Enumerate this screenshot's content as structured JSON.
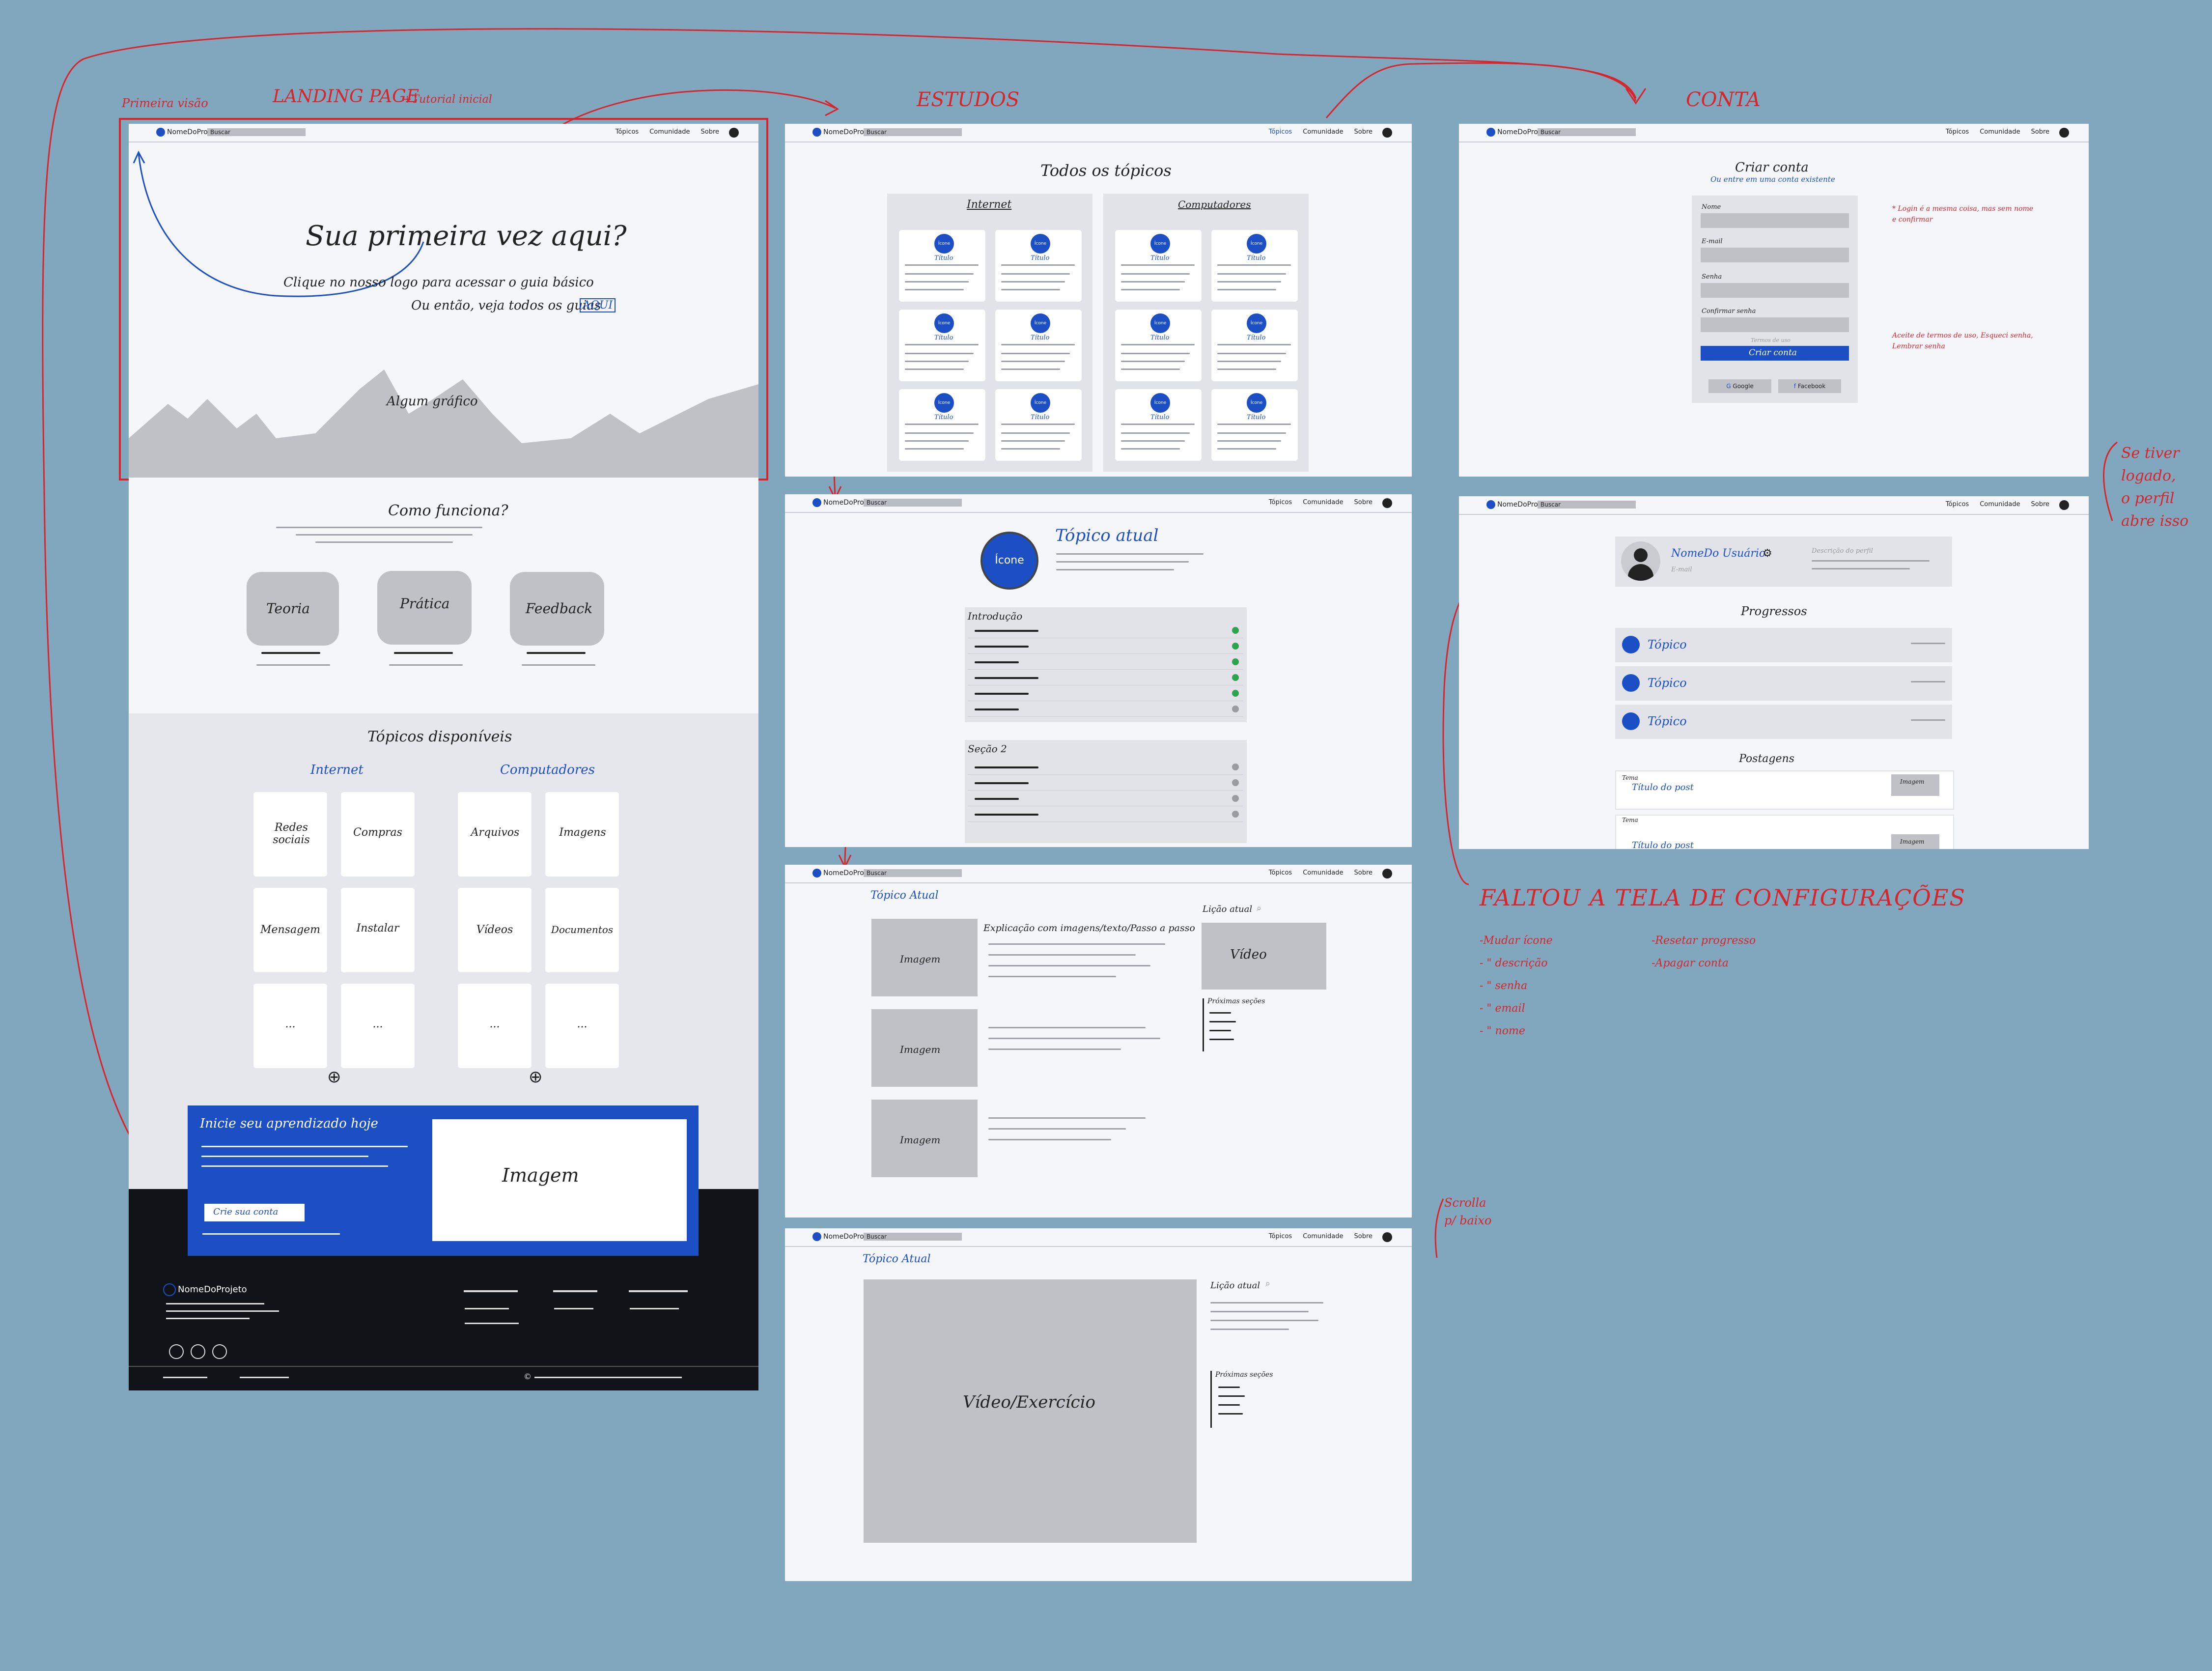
{
  "labels": {
    "primeira_visao": "Primeira visão",
    "landing": "LANDING PAGE",
    "tutorial": "+Tutorial inicial",
    "estudos": "ESTUDOS",
    "conta": "CONTA",
    "se_tiver": "Se tiver",
    "logado": "logado,",
    "o_perfil": "o perfil",
    "abre_isso": "abre isso",
    "scrolla": "Scrolla",
    "pl_baixo": "p/ baixo"
  },
  "nav": {
    "logo": "NomeDoProjeto",
    "search": "Buscar",
    "topicos": "Tópicos",
    "comunidade": "Comunidade",
    "sobre": "Sobre"
  },
  "landing": {
    "hero_title": "Sua primeira vez aqui?",
    "hero_sub1": "Clique no nosso logo para acessar o guia básico",
    "hero_sub2": "Ou então, veja todos os guias",
    "aqui": "AQUI",
    "graph": "Algum gráfico",
    "como": "Como funciona?",
    "features": [
      "Teoria",
      "Prática",
      "Feedback"
    ],
    "topicos_title": "Tópicos disponíveis",
    "col1": "Internet",
    "col2": "Computadores",
    "col1_items": [
      "Redes sociais",
      "Compras",
      "Mensagem",
      "Instalar",
      "...",
      "..."
    ],
    "col2_items": [
      "Arquivos",
      "Imagens",
      "Vídeos",
      "Documentos",
      "...",
      "..."
    ],
    "cta_title": "Inicie seu aprendizado hoje",
    "cta_button": "Crie sua conta",
    "cta_image": "Imagem",
    "footer_logo": "NomeDoProjeto",
    "copyright": "©"
  },
  "estudos": {
    "todos": "Todos os tópicos",
    "internet": "Internet",
    "computadores": "Computadores",
    "card_icon": "Ícone",
    "card_title": "Título",
    "topico_atual": "Tópico atual",
    "icone": "Ícone",
    "introducao": "Introdução",
    "secao2": "Seção 2",
    "topico_atual2": "Tópico Atual",
    "explicacao": "Explicação com imagens/texto/Passo a passo",
    "imagem": "Imagem",
    "licao": "Lição atual",
    "video": "Vídeo",
    "proximas": "Próximas seções",
    "video_exercicio": "Vídeo/Exercício"
  },
  "conta": {
    "criar": "Criar conta",
    "ou_entre": "Ou entre em uma conta existente",
    "nome": "Nome",
    "email": "E-mail",
    "senha": "Senha",
    "confirmar": "Confirmar senha",
    "termos": "Termos de uso",
    "btn": "Criar conta",
    "google": "Google",
    "facebook": "Facebook",
    "note1": "* Login é a mesma coisa, mas sem nome e confirmar",
    "note2": "Aceite de termos de uso, Esqueci senha, Lembrar senha",
    "username": "NomeDo Usuário",
    "user_email": "E-mail",
    "descricao": "Descrição do perfil",
    "progressos": "Progressos",
    "topico": "Tópico",
    "postagens": "Postagens",
    "tema": "Tema",
    "titulo_post": "Título do post",
    "post_imagem": "Imagem"
  },
  "config": {
    "title": "FALTOU A TELA DE CONFIGURAÇÕES",
    "left": [
      "-Mudar ícone",
      "- \" descrição",
      "- \" senha",
      "- \" email",
      "- \" nome"
    ],
    "right": [
      "-Resetar progresso",
      "-Apagar conta"
    ]
  }
}
